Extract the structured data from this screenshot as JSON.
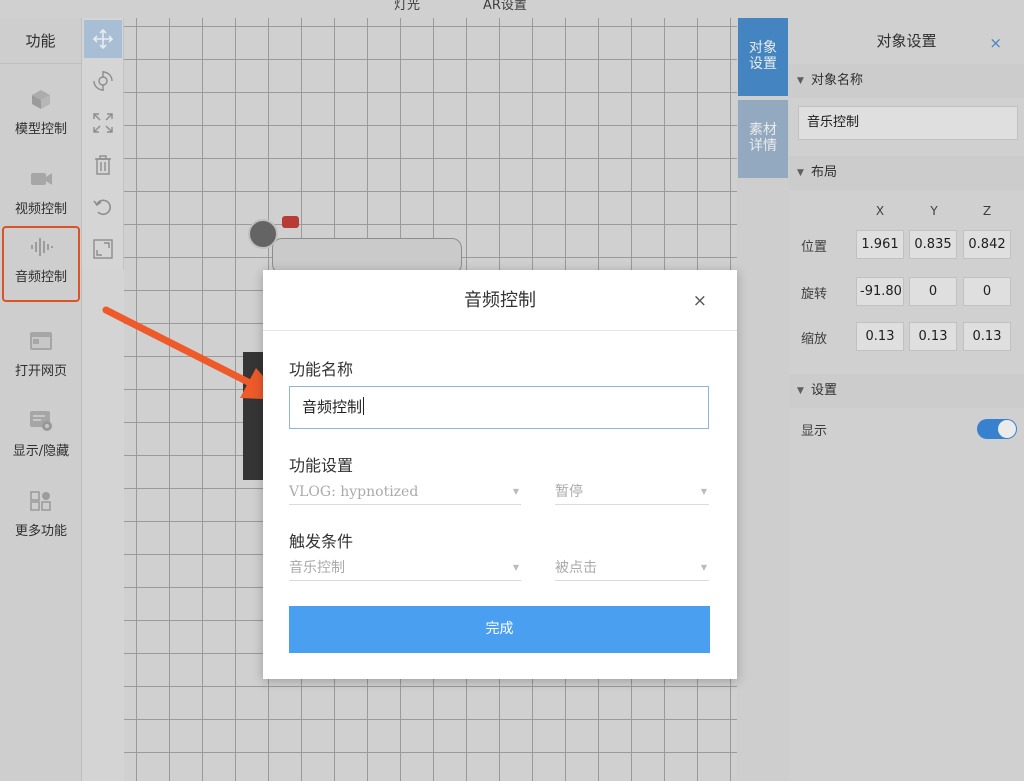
{
  "top_menu": [
    "灯光",
    "AR设置"
  ],
  "left_panel": {
    "title": "功能",
    "items": [
      {
        "label": "模型控制",
        "icon": "cube-icon"
      },
      {
        "label": "视频控制",
        "icon": "video-camera-icon"
      },
      {
        "label": "音频控制",
        "icon": "audio-wave-icon",
        "active": true
      },
      {
        "label": "打开网页",
        "icon": "browser-window-icon"
      },
      {
        "label": "显示/隐藏",
        "icon": "eye-icon"
      },
      {
        "label": "更多功能",
        "icon": "grid-plus-icon"
      }
    ]
  },
  "tools": [
    "move-arrows-icon",
    "rotate-icon",
    "scale-arrows-icon",
    "trash-icon",
    "undo-icon",
    "expand-icon"
  ],
  "side_tabs": [
    {
      "label": "对象设置",
      "active": true
    },
    {
      "label": "素材详情",
      "active": false
    }
  ],
  "right_panel": {
    "title": "对象设置",
    "close": "×",
    "object_name_section": "对象名称",
    "object_name_value": "音乐控制",
    "layout_section": "布局",
    "axes": [
      "X",
      "Y",
      "Z"
    ],
    "rows": [
      {
        "label": "位置",
        "values": [
          "1.961",
          "0.835",
          "0.842"
        ]
      },
      {
        "label": "旋转",
        "values": [
          "-91.80",
          "0",
          "0"
        ]
      },
      {
        "label": "缩放",
        "values": [
          "0.13",
          "0.13",
          "0.13"
        ]
      }
    ],
    "settings_section": "设置",
    "display_label": "显示",
    "display_on": true
  },
  "modal": {
    "title": "音频控制",
    "close": "×",
    "name_label": "功能名称",
    "name_value": "音频控制",
    "settings_label": "功能设置",
    "settings_audio": "VLOG: hypnotized",
    "settings_action": "暂停",
    "trigger_label": "触发条件",
    "trigger_object": "音乐控制",
    "trigger_event": "被点击",
    "done_button": "完成"
  },
  "colors": {
    "accent": "#4a9ff0",
    "highlight": "#ee5a2a",
    "tab_active": "#4a90d2"
  }
}
